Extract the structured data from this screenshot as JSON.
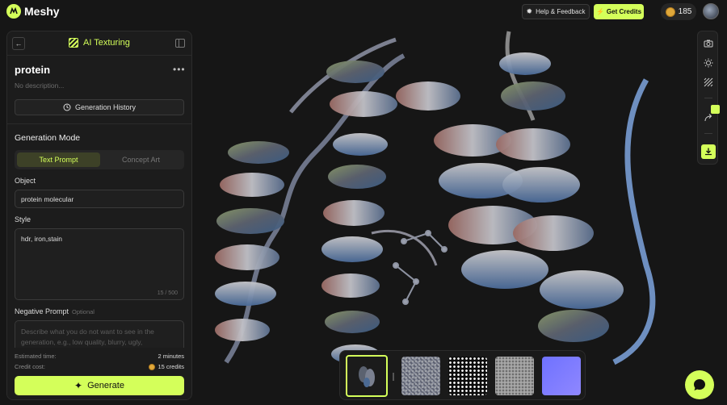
{
  "app": {
    "logo_text": "Meshy"
  },
  "topbar": {
    "help_label": "Help & Feedback",
    "credits_button_label": "Get Credits",
    "credit_balance": "185"
  },
  "panel": {
    "title": "AI Texturing",
    "task_name": "protein",
    "task_description": "No description...",
    "history_label": "Generation History",
    "mode_title": "Generation Mode",
    "tabs": [
      "Text Prompt",
      "Concept Art"
    ],
    "object_label": "Object",
    "object_value": "protein molecular",
    "style_label": "Style",
    "style_value": "hdr, iron,stain",
    "style_counter": "15 / 500",
    "negative_label": "Negative Prompt",
    "negative_optional": "Optional",
    "negative_placeholder": "Describe what you do not want to see in the generation, e.g., low quality, blurry, ugly,",
    "estimated_time_label": "Estimated time:",
    "estimated_time_value": "2 minutes",
    "credit_cost_label": "Credit cost:",
    "credit_cost_value": "15 credits",
    "generate_label": "Generate"
  },
  "colors": {
    "accent": "#d4ff5a",
    "background": "#161616",
    "panel": "#1c1c1c"
  },
  "icons": [
    "camera-icon",
    "light-icon",
    "texture-icon",
    "share-icon",
    "download-icon",
    "chat-icon"
  ]
}
